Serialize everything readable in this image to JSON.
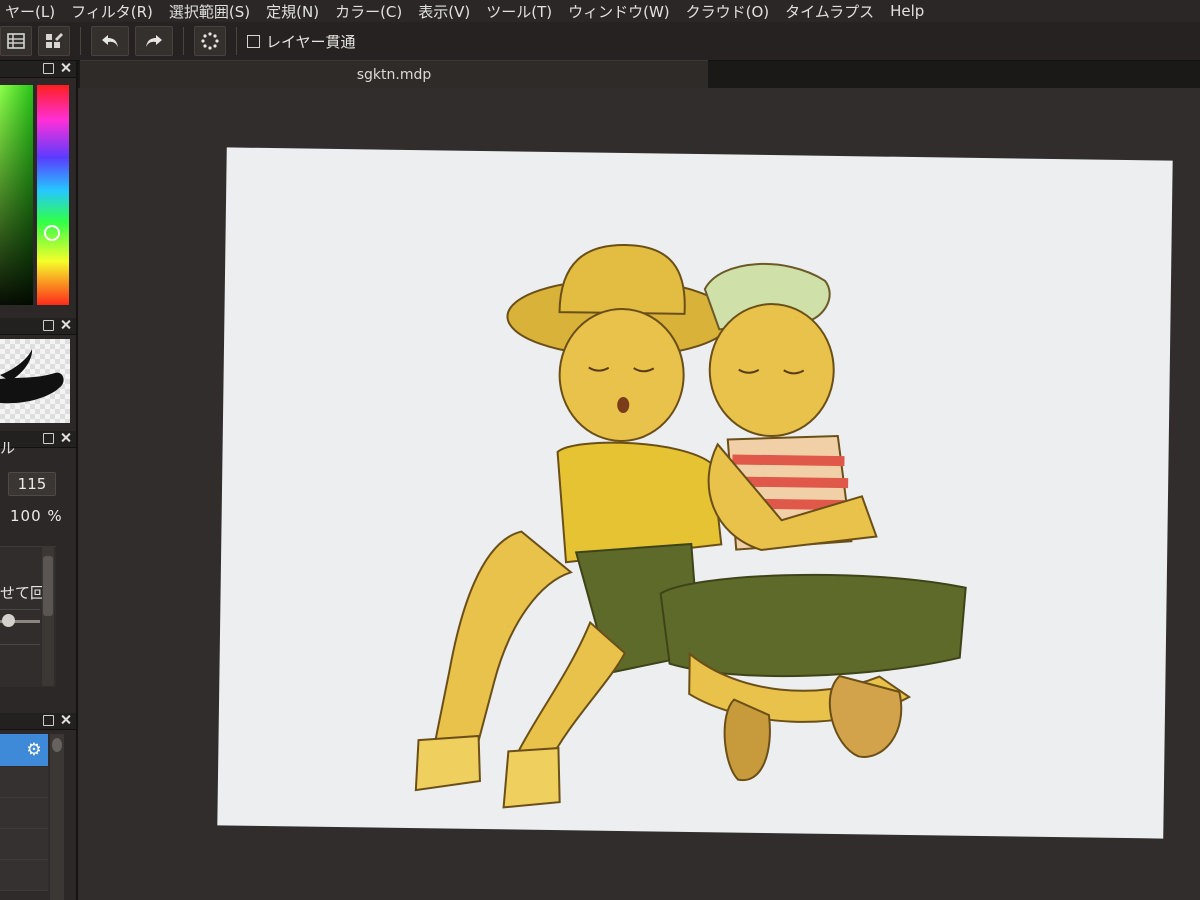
{
  "menu": {
    "items": [
      "ヤー(L)",
      "フィルタ(R)",
      "選択範囲(S)",
      "定規(N)",
      "カラー(C)",
      "表示(V)",
      "ツール(T)",
      "ウィンドウ(W)",
      "クラウド(O)",
      "タイムラプス",
      "Help"
    ]
  },
  "toolbar": {
    "wrap_label": "レイヤー貫通",
    "icons": [
      "layer-list-icon",
      "layer-settings-icon",
      "undo-icon",
      "redo-icon",
      "loading-icon"
    ]
  },
  "document": {
    "tab_title": "sgktn.mdp"
  },
  "brush_panel": {
    "tab_label": "ル",
    "size": "115",
    "opacity": "100 %",
    "stabilizer_label": "せて回"
  },
  "colors": {
    "background": "#1b1918",
    "panel": "#2b2827",
    "canvas": "#eceeef",
    "layer_selected": "#3f8ad8"
  }
}
